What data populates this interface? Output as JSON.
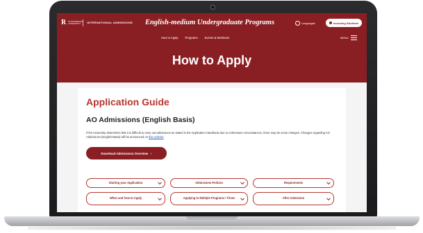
{
  "header": {
    "logo_name": "RITSUMEIKAN UNIVERSITY",
    "logo_r": "R",
    "logo_unit": "INTERNATIONAL ADMISSIONS",
    "site_title": "English-medium Undergraduate Programs",
    "languages_label": "Languages",
    "incoming_label": "Incoming Students",
    "menu_label": "MENU"
  },
  "nav": {
    "items": [
      "How to Apply",
      "Programs",
      "Events & Webinars"
    ]
  },
  "hero": {
    "title": "How to Apply"
  },
  "main": {
    "section_title": "Application Guide",
    "subsection_title": "AO Admissions (English Basis)",
    "paragraph_before_link": "If the University determines that it is difficult to carry out admissions as stated in the Application Handbook due to unforeseen circumstances, there may be some changes. Changes regarding AO Admissions (English Basis) will be announced on ",
    "paragraph_link": "this website",
    "paragraph_after_link": ".",
    "download_label": "Download Admissions Overview",
    "download_arrow": "›"
  },
  "accordions": [
    {
      "label": "Starting your Application"
    },
    {
      "label": "Admissions Policies"
    },
    {
      "label": "Requirements"
    },
    {
      "label": "When and how to Apply"
    },
    {
      "label": "Applying to Multiple Programs / Times"
    },
    {
      "label": "After Admission"
    }
  ],
  "colors": {
    "brand": "#8a1f23",
    "accent": "#b7362e",
    "link": "#2a5db0"
  }
}
